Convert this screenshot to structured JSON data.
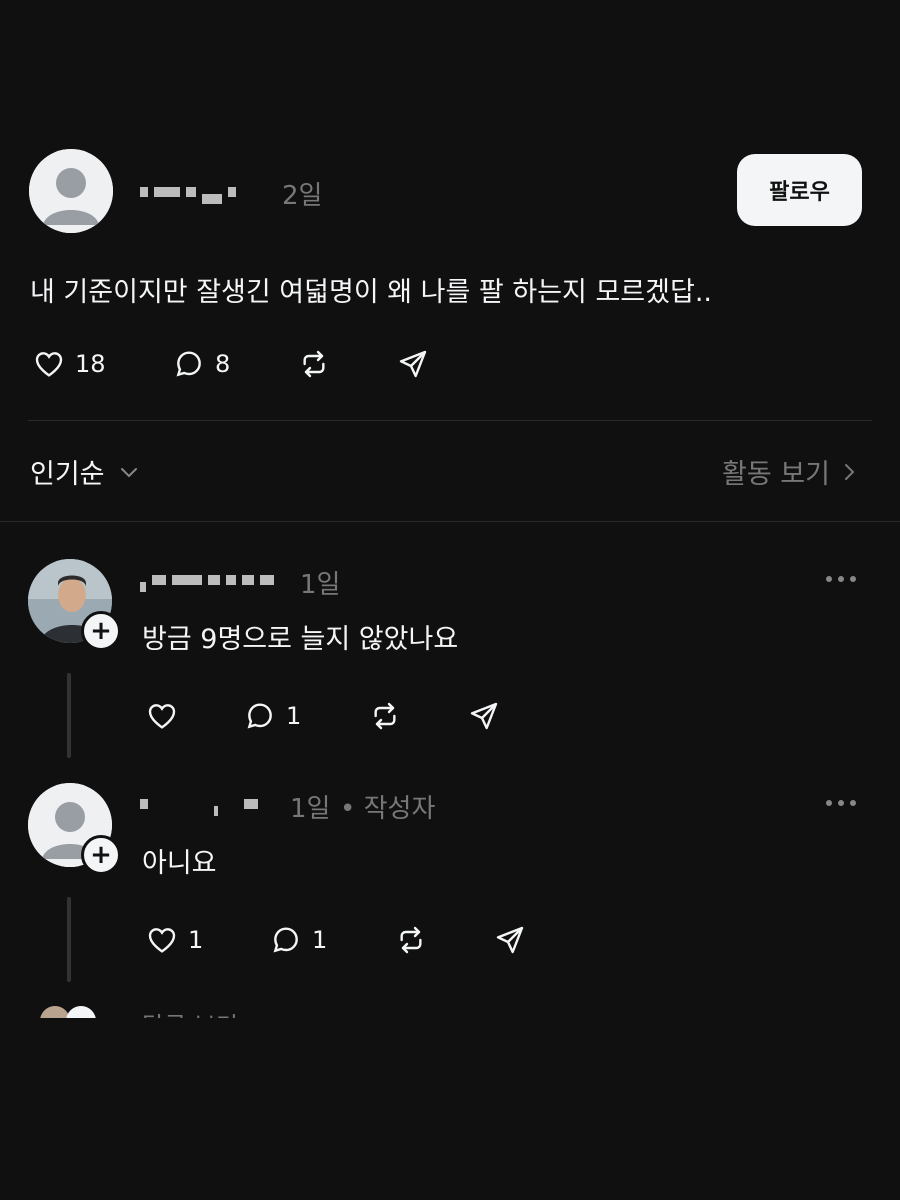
{
  "post": {
    "author_display": "",
    "time": "2일",
    "follow_label": "팔로우",
    "text": "내 기준이지만 잘생긴 여덟명이 왜 나를 팔 하는지 모르겠답..",
    "likes": "18",
    "comments": "8"
  },
  "sort_bar": {
    "sort_label": "인기순",
    "activity_label": "활동 보기"
  },
  "replies": [
    {
      "time": "1일",
      "text": "방금 9명으로 늘지 않았나요",
      "likes": "",
      "comments": "1"
    },
    {
      "time": "1일",
      "author_tag": "• 작성자",
      "text": "아니요",
      "likes": "1",
      "comments": "1"
    }
  ],
  "more_label": "답글 보기",
  "colors": {
    "background": "#101010",
    "text": "#f3f5f7",
    "muted": "#777777"
  }
}
